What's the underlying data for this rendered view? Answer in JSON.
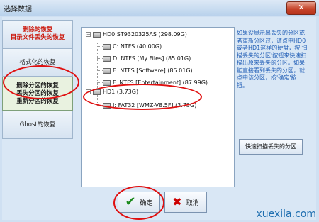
{
  "window": {
    "title": "选择数据",
    "close_symbol": "✕"
  },
  "sidebar": {
    "items": [
      {
        "lines": [
          "删除的恢复",
          "目录文件丢失的恢复"
        ]
      },
      {
        "lines": [
          "格式化的恢复"
        ]
      },
      {
        "lines": [
          "删除分区的恢复",
          "丢失分区的恢复",
          "重新分区的恢复"
        ]
      },
      {
        "lines": [
          "Ghost的恢复"
        ]
      }
    ]
  },
  "tree": {
    "hd0": {
      "label": "HD0  ST9320325AS (298.09G)",
      "partitions": [
        "C:  NTFS  (40.00G)",
        "D:  NTFS  [My Files]  (85.01G)",
        "E:  NTFS  [Software]  (85.01G)",
        "F:  NTFS  [Entertainment]  (87.99G)"
      ]
    },
    "hd1": {
      "label": "HD1  (3.73G)",
      "partitions": [
        "I:  FAT32  [WMZ-V8.5F]  (3.73G)"
      ]
    }
  },
  "hint": {
    "text": "如果没显示出丢失的分区或者重新分区过，请点中HD0或者HD1这样的硬盘，按'扫描丢失的分区'按钮来快速扫描出原来丢失的分区。如果能直接看到丢失的分区，就点中该分区，按'确定'按钮。"
  },
  "buttons": {
    "scan_label": "快速扫描丢失的分区",
    "ok_label": "确定",
    "cancel_label": "取消",
    "ok_icon": "✔",
    "cancel_icon": "✖"
  },
  "watermark": "xuexila.com",
  "colors": {
    "highlight_red": "#e01010",
    "hint_blue": "#2460b7",
    "sidebar_red": "#cc1b0f"
  }
}
